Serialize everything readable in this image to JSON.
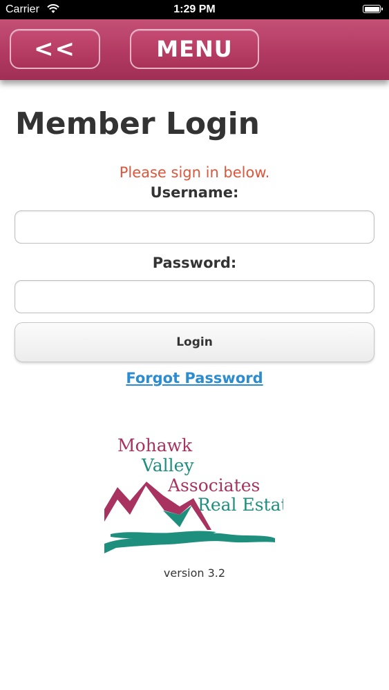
{
  "status_bar": {
    "carrier": "Carrier",
    "time": "1:29 PM"
  },
  "header": {
    "back_label": "<<",
    "menu_label": "MENU"
  },
  "page": {
    "title": "Member Login",
    "signin_message": "Please sign in below.",
    "username_label": "Username:",
    "username_value": "",
    "password_label": "Password:",
    "password_value": "",
    "login_label": "Login",
    "forgot_label": "Forgot Password",
    "version": "version 3.2"
  },
  "logo": {
    "line1": "Mohawk",
    "line2": "Valley",
    "line3": "Associates",
    "line4": "Real Estate"
  },
  "colors": {
    "header": "#b23a62",
    "message": "#e0553a",
    "link": "#2b8ccf",
    "logo_magenta": "#a83260",
    "logo_teal": "#1f8f7d"
  }
}
